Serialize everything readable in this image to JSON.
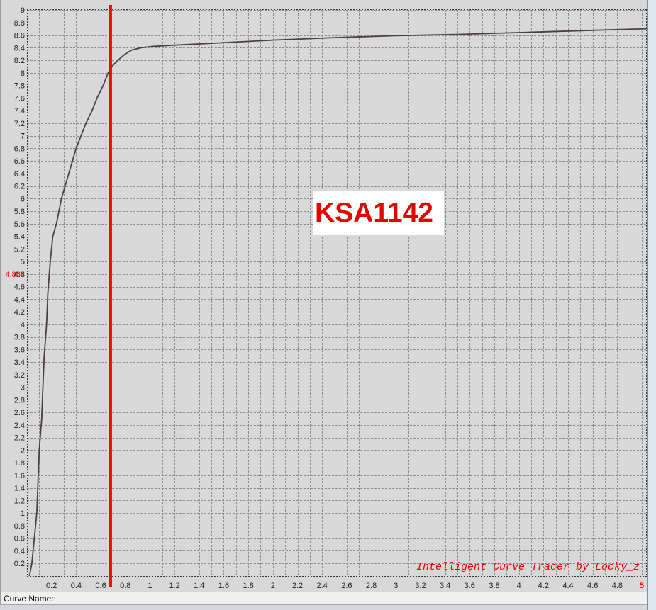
{
  "app": {
    "watermark": "Intelligent Curve Tracer by Locky_z"
  },
  "status_bar": {
    "curve_name_label": "Curve Name:"
  },
  "colors": {
    "background": "#d8d8d8",
    "grid": "#8c8c8c",
    "axis": "#333333",
    "curve": "#4a3f3f",
    "cursor": "#ff0000",
    "readout": "#ff0000",
    "title_text": "#e60000",
    "title_background": "#ffffff",
    "watermark": "#e00000"
  },
  "chart_data": {
    "type": "line",
    "title": "KSA1142",
    "xlim": [
      0,
      5.04
    ],
    "ylim": [
      0,
      9
    ],
    "grid": true,
    "x_ticks": [
      "0.2",
      "0.4",
      "0.6",
      "0.8",
      "1",
      "1.2",
      "1.4",
      "1.6",
      "1.8",
      "2",
      "2.2",
      "2.4",
      "2.6",
      "2.8",
      "3",
      "3.2",
      "3.4",
      "3.6",
      "3.8",
      "4",
      "4.2",
      "4.4",
      "4.6",
      "4.8",
      "5"
    ],
    "y_ticks": [
      "0.2",
      "0.4",
      "0.6",
      "0.8",
      "1",
      "1.2",
      "1.4",
      "1.6",
      "1.8",
      "2",
      "2.2",
      "2.4",
      "2.6",
      "2.8",
      "3",
      "3.2",
      "3.4",
      "3.6",
      "3.8",
      "4",
      "4.2",
      "4.4",
      "4.6",
      "4.8",
      "5",
      "5.2",
      "5.4",
      "5.6",
      "5.8",
      "6",
      "6.2",
      "6.4",
      "6.6",
      "6.8",
      "7",
      "7.2",
      "7.4",
      "7.6",
      "7.8",
      "8",
      "8.2",
      "8.4",
      "8.6",
      "8.8",
      "9"
    ],
    "series": [
      {
        "x": [
          0.02,
          0.04,
          0.06,
          0.08,
          0.09,
          0.1,
          0.12,
          0.13,
          0.14,
          0.16,
          0.17,
          0.19,
          0.21,
          0.24,
          0.26,
          0.28,
          0.31,
          0.34,
          0.37,
          0.4,
          0.44,
          0.48,
          0.53,
          0.57,
          0.62,
          0.66,
          0.69,
          0.74,
          0.8,
          0.85,
          0.93,
          1.02,
          1.2,
          1.5,
          2.0,
          2.5,
          3.0,
          3.5,
          4.0,
          4.5,
          5.04
        ],
        "y": [
          0,
          0.2,
          0.6,
          1.0,
          1.5,
          2.0,
          2.5,
          3.0,
          3.5,
          4.0,
          4.5,
          5.0,
          5.4,
          5.6,
          5.8,
          6.0,
          6.2,
          6.4,
          6.6,
          6.8,
          7.0,
          7.2,
          7.4,
          7.6,
          7.8,
          8.0,
          8.1,
          8.2,
          8.3,
          8.36,
          8.4,
          8.42,
          8.44,
          8.47,
          8.52,
          8.56,
          8.59,
          8.61,
          8.64,
          8.67,
          8.7
        ]
      }
    ],
    "cursor_x": 0.68,
    "y_readout": "4.864",
    "x_readout": "5"
  }
}
